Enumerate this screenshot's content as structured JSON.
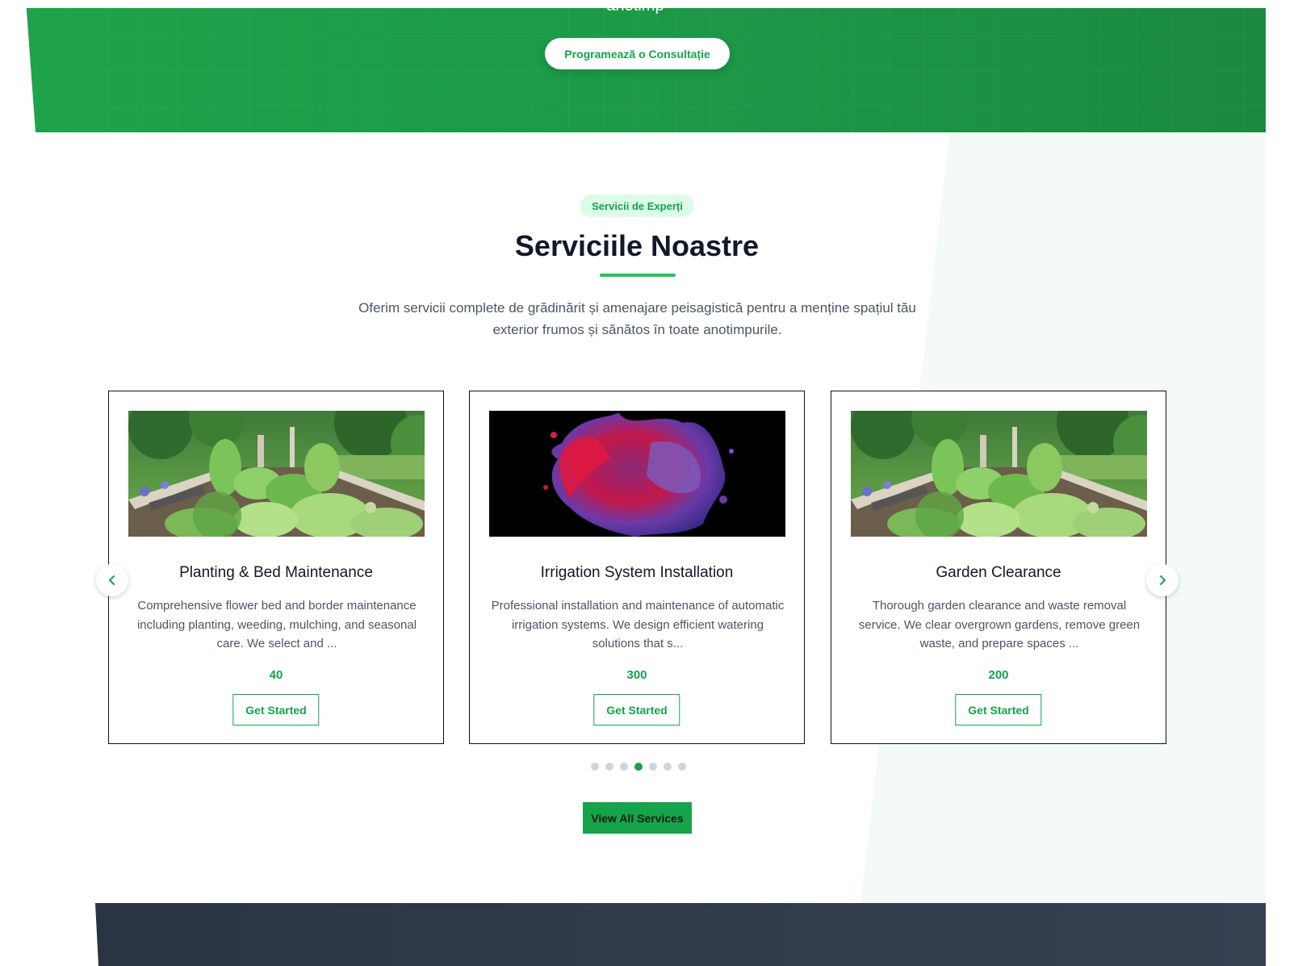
{
  "hero": {
    "cut_text": "anotimp",
    "cta_label": "Programează o Consultație"
  },
  "services": {
    "badge": "Servicii de Experți",
    "title": "Serviciile Noastre",
    "description": "Oferim servicii complete de grădinărit și amenajare peisagistică pentru a menține spațiul tău exterior frumos și sănătos în toate anotimpurile.",
    "cards": [
      {
        "title": "Planting & Bed Maintenance",
        "text": "Comprehensive flower bed and border maintenance including planting, weeding, mulching, and seasonal care. We select and ...",
        "price": "40",
        "button": "Get Started",
        "image": "garden-raised-bed-photo"
      },
      {
        "title": "Irrigation System Installation",
        "text": "Professional installation and maintenance of automatic irrigation systems. We design efficient watering solutions that s...",
        "price": "300",
        "button": "Get Started",
        "image": "paint-splash-photo"
      },
      {
        "title": "Garden Clearance",
        "text": "Thorough garden clearance and waste removal service. We clear overgrown gardens, remove green waste, and prepare spaces ...",
        "price": "200",
        "button": "Get Started",
        "image": "garden-raised-bed-photo"
      }
    ],
    "carousel": {
      "dot_count": 7,
      "active_index": 3,
      "prev_icon": "chevron-left-icon",
      "next_icon": "chevron-right-icon"
    },
    "view_all_label": "View All Services"
  },
  "colors": {
    "accent": "#16a34a",
    "badge_bg": "#dcfce7",
    "hero_green": "#1c9a47",
    "footer_dark": "#2f3846"
  }
}
